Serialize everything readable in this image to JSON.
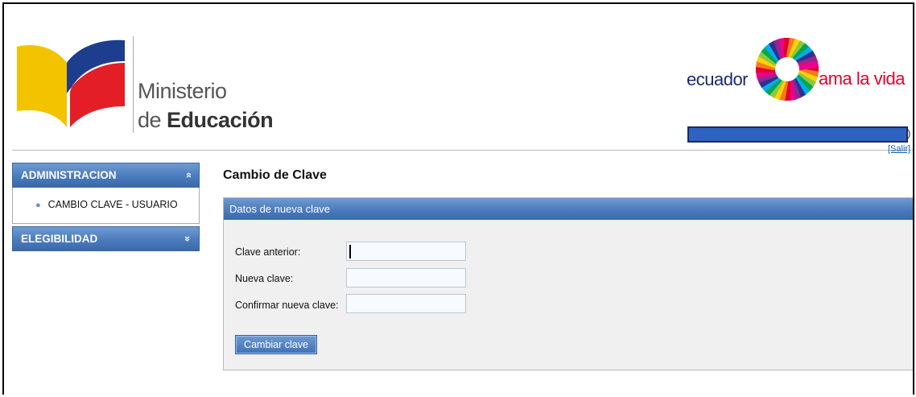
{
  "header": {
    "ministerio_line1": "Ministerio",
    "ministerio_line2_prefix": "de ",
    "ministerio_line2_bold": "Educación",
    "ecuador": "ecuador",
    "ama_la_vida": "ama la vida",
    "user_paren": ")",
    "salir": "[Salir]"
  },
  "sidebar": {
    "sections": [
      {
        "label": "ADMINISTRACION",
        "chevron": "»",
        "expanded": true,
        "items": [
          {
            "label": "CAMBIO CLAVE - USUARIO"
          }
        ]
      },
      {
        "label": "ELEGIBILIDAD",
        "chevron": "»",
        "expanded": false
      }
    ]
  },
  "main": {
    "title": "Cambio de Clave",
    "panel_title": "Datos de nueva clave",
    "fields": [
      {
        "label": "Clave anterior:",
        "value": ""
      },
      {
        "label": "Nueva clave:",
        "value": ""
      },
      {
        "label": "Confirmar nueva clave:",
        "value": ""
      }
    ],
    "submit_label": "Cambiar clave"
  },
  "colors": {
    "accent_blue": "#4a7bbd",
    "link_blue": "#0b5dc1",
    "ama_red": "#e4002b",
    "ecuador_navy": "#1a2a6e"
  }
}
